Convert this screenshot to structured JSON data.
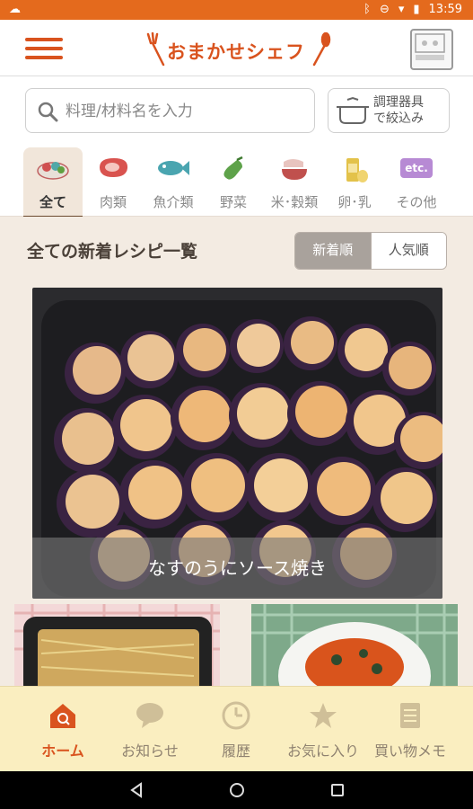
{
  "status": {
    "time": "13:59"
  },
  "app": {
    "title": "おまかせシェフ"
  },
  "search": {
    "placeholder": "料理/材料名を入力",
    "value": ""
  },
  "filter": {
    "line1": "調理器具",
    "line2": "で絞込み"
  },
  "categories": [
    {
      "label": "全て",
      "icon": "all-food-icon",
      "active": true
    },
    {
      "label": "肉類",
      "icon": "meat-icon"
    },
    {
      "label": "魚介類",
      "icon": "fish-icon"
    },
    {
      "label": "野菜",
      "icon": "eggplant-icon"
    },
    {
      "label": "米･穀類",
      "icon": "rice-icon"
    },
    {
      "label": "卵･乳",
      "icon": "egg-milk-icon"
    },
    {
      "label": "その他",
      "icon": "etc-icon",
      "badge": "etc."
    }
  ],
  "list": {
    "title": "全ての新着レシピ一覧",
    "sort": {
      "new": "新着順",
      "popular": "人気順",
      "selected": "新着順"
    }
  },
  "featured": {
    "name": "なすのうにソース焼き"
  },
  "nav": {
    "items": [
      {
        "label": "ホーム",
        "icon": "home-icon",
        "active": true
      },
      {
        "label": "お知らせ",
        "icon": "speech-bubble-icon"
      },
      {
        "label": "履歴",
        "icon": "clock-icon"
      },
      {
        "label": "お気に入り",
        "icon": "star-icon"
      },
      {
        "label": "買い物メモ",
        "icon": "memo-icon"
      }
    ]
  },
  "colors": {
    "accent": "#d9531e",
    "statusbar": "#e46a1d",
    "navbg": "#faeec0",
    "pagebg": "#f3ebe2"
  }
}
